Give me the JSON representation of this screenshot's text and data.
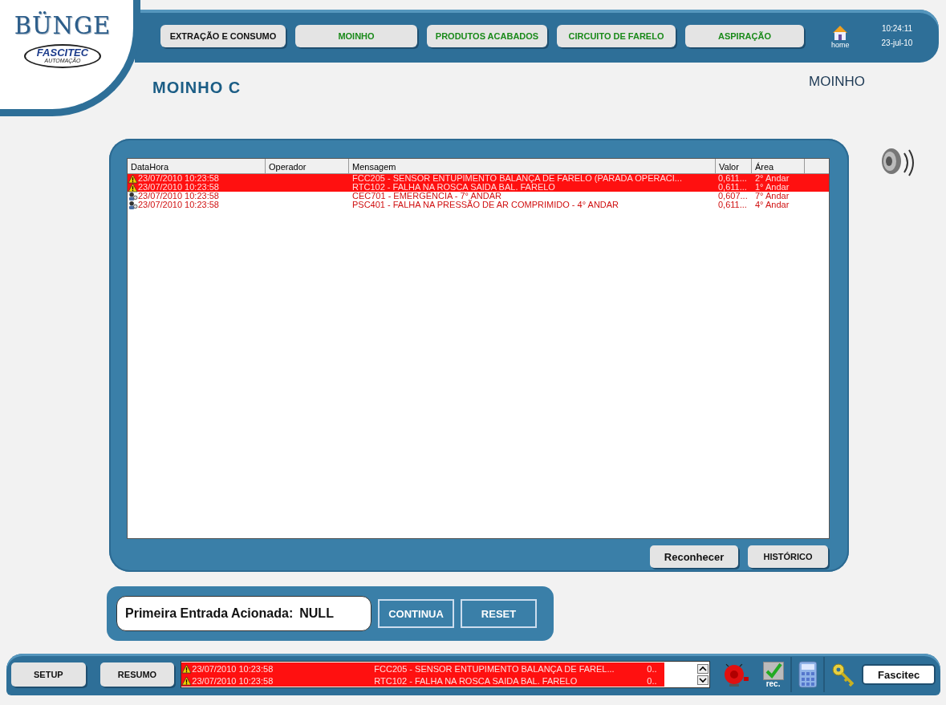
{
  "logo": {
    "brand": "BÜNGE",
    "partner": "FASCITEC",
    "partner_tagline": "AUTOMAÇÃO"
  },
  "nav_tabs": [
    {
      "label": "EXTRAÇÃO E CONSUMO",
      "selected": true
    },
    {
      "label": "MOINHO",
      "selected": false
    },
    {
      "label": "PRODUTOS ACABADOS",
      "selected": false
    },
    {
      "label": "CIRCUITO DE FARELO",
      "selected": false
    },
    {
      "label": "ASPIRAÇÃO",
      "selected": false
    }
  ],
  "home": {
    "label": "home"
  },
  "clock": {
    "time": "10:24:11",
    "date": "23-jul-10"
  },
  "page_title": "MOINHO C",
  "section_label": "MOINHO",
  "alarm_table": {
    "columns": [
      "DataHora",
      "Operador",
      "Mensagem",
      "Valor",
      "Área"
    ],
    "rows": [
      {
        "kind": "warning",
        "highlighted": true,
        "datetime": "23/07/2010 10:23:58",
        "message": "FCC205 - SENSOR ENTUPIMENTO BALANÇA DE FARELO (PARADA OPERACI...",
        "value": "0,611...",
        "area": "2° Andar"
      },
      {
        "kind": "warning",
        "highlighted": true,
        "datetime": "23/07/2010 10:23:58",
        "message": "RTC102 - FALHA NA ROSCA SAIDA BAL. FARELO",
        "value": "0,611...",
        "area": "1° Andar"
      },
      {
        "kind": "operator",
        "highlighted": false,
        "datetime": "23/07/2010 10:23:58",
        "message": "CEC701 - EMERGÊNCIA - 7° ANDAR",
        "value": "0,607...",
        "area": "7° Andar"
      },
      {
        "kind": "operator",
        "highlighted": false,
        "datetime": "23/07/2010 10:23:58",
        "message": "PSC401 - FALHA NA PRESSÃO DE AR COMPRIMIDO - 4° ANDAR",
        "value": "0,611...",
        "area": "4° Andar"
      }
    ],
    "buttons": [
      "Reconhecer",
      "HISTÓRICO"
    ]
  },
  "first_input": {
    "label": "Primeira Entrada Acionada:",
    "value": "NULL",
    "buttons": [
      "CONTINUA",
      "RESET"
    ]
  },
  "bottom_bar": {
    "buttons": [
      "SETUP",
      "RESUMO"
    ],
    "alarm_strip": [
      {
        "kind": "warning",
        "datetime": "23/07/2010 10:23:58",
        "message": "FCC205 - SENSOR ENTUPIMENTO BALANÇA DE FAREL...",
        "value": "0.."
      },
      {
        "kind": "warning",
        "datetime": "23/07/2010 10:23:58",
        "message": "RTC102 - FALHA NA ROSCA SAIDA BAL. FARELO",
        "value": "0.."
      }
    ],
    "ack_label": "rec.",
    "user": "Fascitec"
  }
}
